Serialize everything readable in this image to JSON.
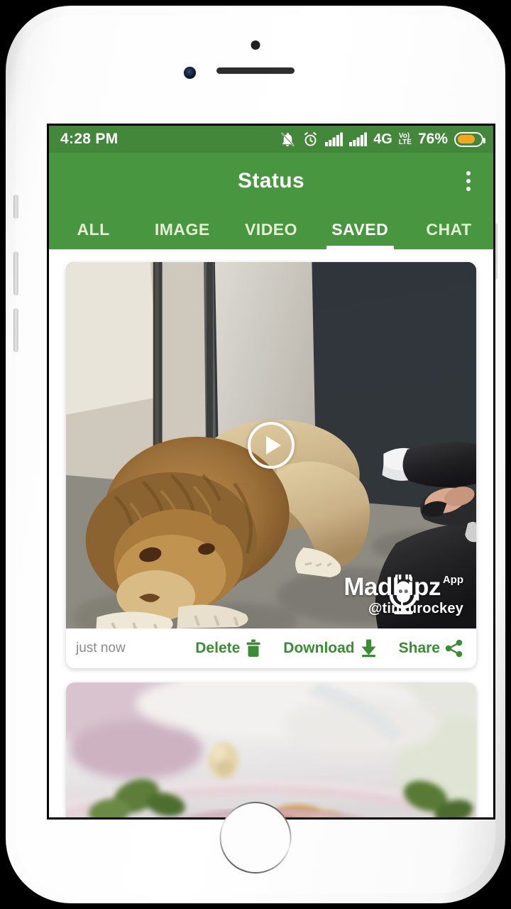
{
  "status_bar": {
    "time": "4:28 PM",
    "network_type": "4G",
    "volte_top": "Vo)",
    "volte_bottom": "LTE",
    "battery_percent": "76%",
    "battery_level": 76,
    "icons": [
      "notifications-off-icon",
      "alarm-icon",
      "signal-bars-icon",
      "signal-bars-icon",
      "volte-icon",
      "battery-icon"
    ]
  },
  "app_bar": {
    "title": "Status",
    "overflow_menu": "overflow-menu-icon"
  },
  "tabs": [
    {
      "label": "ALL",
      "active": false
    },
    {
      "label": "IMAGE",
      "active": false
    },
    {
      "label": "VIDEO",
      "active": false
    },
    {
      "label": "SAVED",
      "active": true
    },
    {
      "label": "CHAT",
      "active": false
    }
  ],
  "cards": [
    {
      "type": "video",
      "timestamp": "just now",
      "play_label": "play-icon",
      "watermark": {
        "brand": "MadLipz",
        "badge": "App",
        "handle": "@tinkurockey"
      },
      "actions": [
        {
          "label": "Delete",
          "icon": "trash-icon"
        },
        {
          "label": "Download",
          "icon": "download-icon"
        },
        {
          "label": "Share",
          "icon": "share-icon"
        }
      ]
    },
    {
      "type": "image"
    }
  ],
  "colors": {
    "app_bar_green": "#489740",
    "status_bar_green": "#42873a",
    "action_green": "#3d8b35",
    "battery_orange": "#f5a623",
    "tab_inactive": "#e4efd2",
    "tab_active": "#ffffff",
    "timestamp_gray": "#8b8b8b",
    "screen_background": "#ffffff"
  }
}
